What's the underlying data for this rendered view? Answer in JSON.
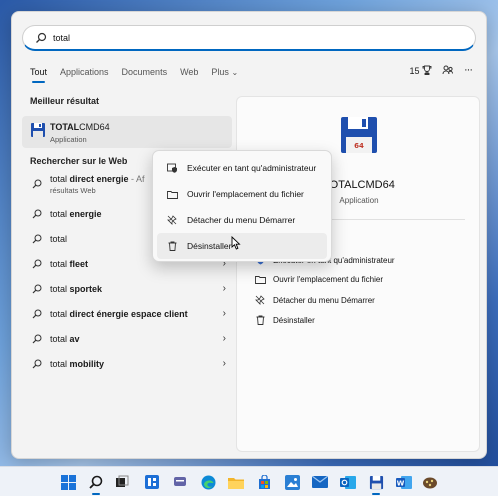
{
  "search": {
    "value": "total"
  },
  "tabs": [
    {
      "label": "Tout",
      "active": true
    },
    {
      "label": "Applications"
    },
    {
      "label": "Documents"
    },
    {
      "label": "Web"
    },
    {
      "label": "Plus"
    }
  ],
  "header_right": {
    "points": "15"
  },
  "best_match": {
    "title": "Meilleur résultat",
    "name_bold": "TOTAL",
    "name_rest": "CMD64",
    "type": "Application"
  },
  "web": {
    "title": "Rechercher sur le Web",
    "first": {
      "prefix": "total ",
      "bold": "direct energie",
      "suffix": " - Af",
      "sub": "résultats Web"
    },
    "items": [
      {
        "prefix": "total ",
        "bold": "energie"
      },
      {
        "prefix": "total",
        "bold": ""
      },
      {
        "prefix": "total ",
        "bold": "fleet"
      },
      {
        "prefix": "total ",
        "bold": "sportek"
      },
      {
        "prefix": "total ",
        "bold": "direct énergie espace client"
      },
      {
        "prefix": "total ",
        "bold": "av"
      },
      {
        "prefix": "total ",
        "bold": "mobility"
      }
    ]
  },
  "detail": {
    "app_name": "TOTALCMD64",
    "app_type": "Application",
    "actions": [
      "Exécuter en tant qu'administrateur",
      "Ouvrir l'emplacement du fichier",
      "Détacher du menu Démarrer",
      "Désinstaller"
    ]
  },
  "context_menu": {
    "items": [
      "Exécuter en tant qu'administrateur",
      "Ouvrir l'emplacement du fichier",
      "Détacher du menu Démarrer",
      "Désinstaller"
    ]
  },
  "colors": {
    "accent": "#0067c0",
    "floppy": "#1f4fae"
  }
}
